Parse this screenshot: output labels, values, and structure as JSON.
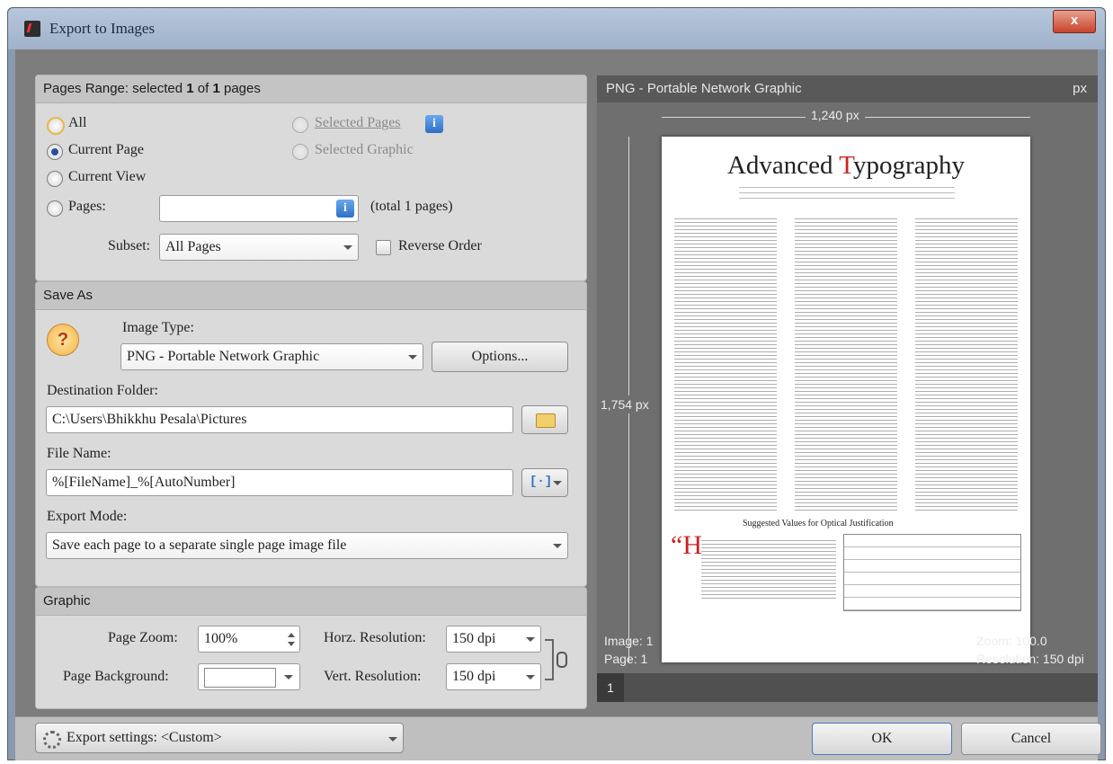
{
  "window": {
    "title": "Export to Images",
    "close_label": "x"
  },
  "pages_range": {
    "header_prefix": "Pages Range: selected ",
    "selected": "1",
    "header_mid": " of ",
    "total": "1",
    "header_suffix": " pages",
    "options": {
      "all": "All",
      "current_page": "Current Page",
      "current_view": "Current View",
      "pages": "Pages:",
      "selected_pages": "Selected Pages",
      "selected_graphic": "Selected Graphic"
    },
    "pages_value": "",
    "total_pages_note": "(total 1 pages)",
    "subset_label": "Subset:",
    "subset_value": "All Pages",
    "reverse_order": "Reverse Order",
    "info_glyph": "i"
  },
  "save_as": {
    "header": "Save As",
    "help_glyph": "?",
    "image_type_label": "Image Type:",
    "image_type_value": "PNG - Portable Network Graphic",
    "options_button": "Options...",
    "destination_label": "Destination Folder:",
    "destination_value": "C:\\Users\\Bhikkhu Pesala\\Pictures",
    "file_name_label": "File Name:",
    "file_name_value": "%[FileName]_%[AutoNumber]",
    "macro_glyph": "[·]",
    "export_mode_label": "Export Mode:",
    "export_mode_value": "Save each page to a separate single page image file"
  },
  "graphic": {
    "header": "Graphic",
    "page_zoom_label": "Page Zoom:",
    "page_zoom_value": "100%",
    "page_background_label": "Page Background:",
    "horz_res_label": "Horz. Resolution:",
    "horz_res_value": "150 dpi",
    "vert_res_label": "Vert. Resolution:",
    "vert_res_value": "150 dpi"
  },
  "preview": {
    "format_title": "PNG - Portable Network Graphic",
    "unit": "px",
    "width_label": "1,240 px",
    "height_label": "1,754 px",
    "image_info": "Image: 1",
    "page_info": "Page: 1",
    "zoom_info": "Zoom: 100.0",
    "resolution_info": "Resolution: 150 dpi",
    "page_tab": "1",
    "doc_title_a": "Advanced ",
    "doc_title_b": "T",
    "doc_title_c": "ypography",
    "doc_table_title": "Suggested Values for Optical Justification",
    "doc_dropcap": "“H"
  },
  "footer": {
    "export_settings_label": "Export settings: <Custom>",
    "ok_button": "OK",
    "cancel_button": "Cancel"
  },
  "colors": {
    "accent_red": "#cc2222",
    "info_blue": "#2f6fc4",
    "panel": "#dadada"
  }
}
